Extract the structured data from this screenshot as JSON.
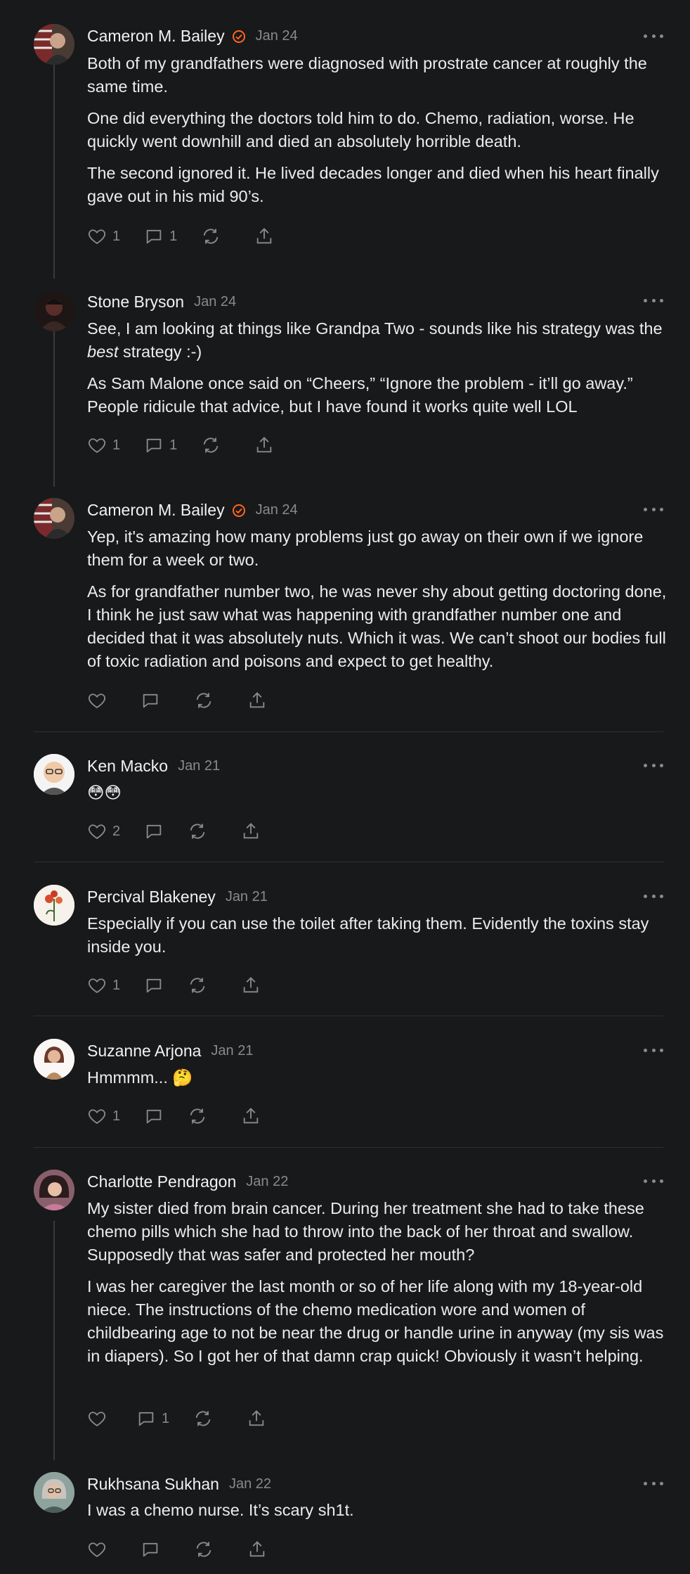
{
  "comments": [
    {
      "author": "Cameron M. Bailey",
      "verified": true,
      "date": "Jan 24",
      "paragraphs": [
        "Both of my grandfathers were diagnosed with prostrate cancer at roughly the same time.",
        "One did everything the doctors told him to do. Chemo, radiation, worse. He quickly went downhill and died an absolutely horrible death.",
        "The second ignored it. He lived decades longer and died when his heart finally gave out in his mid 90’s."
      ],
      "likes": "1",
      "replies": "1"
    },
    {
      "author": "Stone Bryson",
      "verified": false,
      "date": "Jan 24",
      "paragraphs": [
        "See, I am looking at things like Grandpa Two - sounds like his strategy was the best strategy :-)",
        "As Sam Malone once said on “Cheers,” “Ignore the problem - it’ll go away.” People ridicule that advice, but I have found it works quite well LOL"
      ],
      "likes": "1",
      "replies": "1"
    },
    {
      "author": "Cameron M. Bailey",
      "verified": true,
      "date": "Jan 24",
      "paragraphs": [
        "Yep, it's amazing how many problems just go away on their own if we ignore them for a week or two.",
        "As for grandfather number two, he was never shy about getting doctoring done, I think he just saw what was happening with grandfather number one and decided that it was absolutely nuts. Which it was. We can’t shoot our bodies full of toxic radiation and poisons and expect to get healthy."
      ],
      "likes": "",
      "replies": ""
    },
    {
      "author": "Ken Macko",
      "verified": false,
      "date": "Jan 21",
      "paragraphs": [
        "😳😳"
      ],
      "likes": "2",
      "replies": ""
    },
    {
      "author": "Percival Blakeney",
      "verified": false,
      "date": "Jan 21",
      "paragraphs": [
        "Especially if you can use the toilet after taking them. Evidently the toxins stay inside you."
      ],
      "likes": "1",
      "replies": ""
    },
    {
      "author": "Suzanne Arjona",
      "verified": false,
      "date": "Jan 21",
      "paragraphs": [
        "Hmmmm... 🤔"
      ],
      "likes": "1",
      "replies": ""
    },
    {
      "author": "Charlotte Pendragon",
      "verified": false,
      "date": "Jan 22",
      "paragraphs": [
        "My sister died from brain cancer. During her treatment she had to take these chemo pills which she had to throw into the back of her throat and swallow. Supposedly that was safer and protected her mouth?",
        "I was her caregiver the last month or so of her life along with my 18-year-old niece. The instructions of the chemo medication wore and women of childbearing age to not be near the drug or handle urine in anyway (my sis was in diapers). So I got her of that damn crap quick! Obviously it wasn’t helping."
      ],
      "likes": "",
      "replies": "1"
    },
    {
      "author": "Rukhsana Sukhan",
      "verified": false,
      "date": "Jan 22",
      "paragraphs": [
        "I was a chemo nurse. It’s scary sh1t."
      ],
      "likes": "",
      "replies": ""
    }
  ],
  "colors": {
    "background": "#18191b",
    "text": "#ececec",
    "muted": "#8a8a8e",
    "verified_accent": "#ff6719"
  },
  "icons": {
    "like": "heart-icon",
    "reply": "comment-bubble-icon",
    "restack": "restack-icon",
    "share": "share-icon",
    "menu": "more-dots-icon",
    "verified": "verified-badge-icon"
  }
}
